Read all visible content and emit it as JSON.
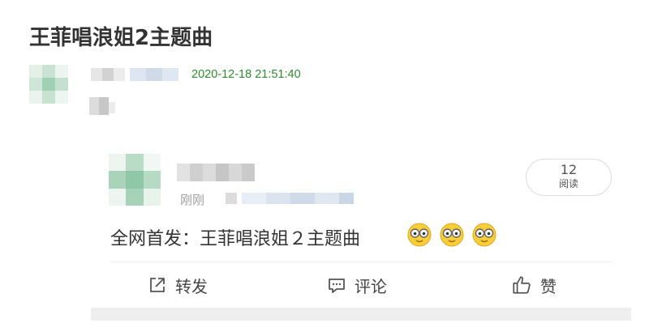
{
  "page_title": "王菲唱浪姐2主题曲",
  "post": {
    "timestamp": "2020-12-18 21:51:40"
  },
  "card": {
    "meta_time": "刚刚",
    "read_count": "12",
    "read_label": "阅读",
    "text": "全网首发：王菲唱浪姐２主题曲",
    "emojis": [
      "nerd-emoji-icon",
      "nerd-emoji-icon",
      "nerd-emoji-icon"
    ]
  },
  "actions": {
    "repost_label": "转发",
    "comment_label": "评论",
    "like_label": "赞"
  },
  "colors": {
    "timestamp": "#2e8b2e",
    "meta": "#a0a0a0",
    "strip": "#efefef"
  }
}
